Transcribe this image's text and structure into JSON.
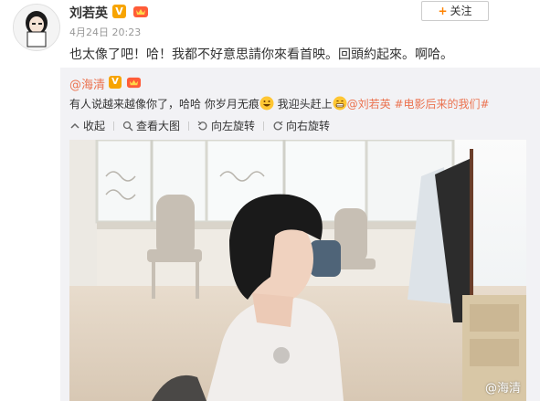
{
  "post": {
    "username": "刘若英",
    "v_badge": "V",
    "timestamp": "4月24日 20:23",
    "follow_label": "关注",
    "follow_plus": "+",
    "text": "也太像了吧！哈！我都不好意思請你來看首映。回頭約起來。啊哈。"
  },
  "repost": {
    "username": "@海清",
    "v_badge": "V",
    "text_before": "有人说越来越像你了，哈哈 你岁月无痕",
    "text_mid": " 我迎头赶上",
    "mention": "@刘若英",
    "hashtag": " #电影后来的我们#",
    "toolbar": {
      "collapse": "收起",
      "view_large": "查看大图",
      "rotate_left": "向左旋转",
      "rotate_right": "向右旋转"
    },
    "watermark": "@海清"
  },
  "colors": {
    "link": "#eb7350",
    "badge": "#f7a400",
    "repost_bg": "#f2f2f5"
  }
}
